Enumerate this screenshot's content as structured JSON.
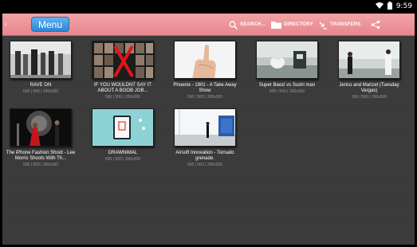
{
  "status": {
    "time": "9:59"
  },
  "toolbar": {
    "menu_label": "Menu",
    "search_label": "SEARCH...",
    "directory_label": "DIRECTORY",
    "transfers_label": "TRANSFERS"
  },
  "videos": [
    {
      "title": "RAVE ON",
      "meta": "500 | 500 | 200x300"
    },
    {
      "title": "IF YOU WOULDNT SAY IT ABOUT A BOOB JOB...",
      "meta": "500 | 500 | 200x300"
    },
    {
      "title": "Phoenix - 1901 - A Take Away Show",
      "meta": "500 | 500 | 200x300"
    },
    {
      "title": "Super Baozi vs Sushi man",
      "meta": "500 | 500 | 200x300"
    },
    {
      "title": "Jerico and Marizel (Tuesday Vargas)",
      "meta": "500 | 500 | 200x300"
    },
    {
      "title": "The iPhone Fashion Shoot - Lee Morris Shoots With Th...",
      "meta": "500 | 500 | 200x300"
    },
    {
      "title": "DRAWNIMAL",
      "meta": "500 | 500 | 200x300"
    },
    {
      "title": "Airsoft Innovation - Tornado grenade.",
      "meta": "500 | 500 | 200x300"
    }
  ]
}
